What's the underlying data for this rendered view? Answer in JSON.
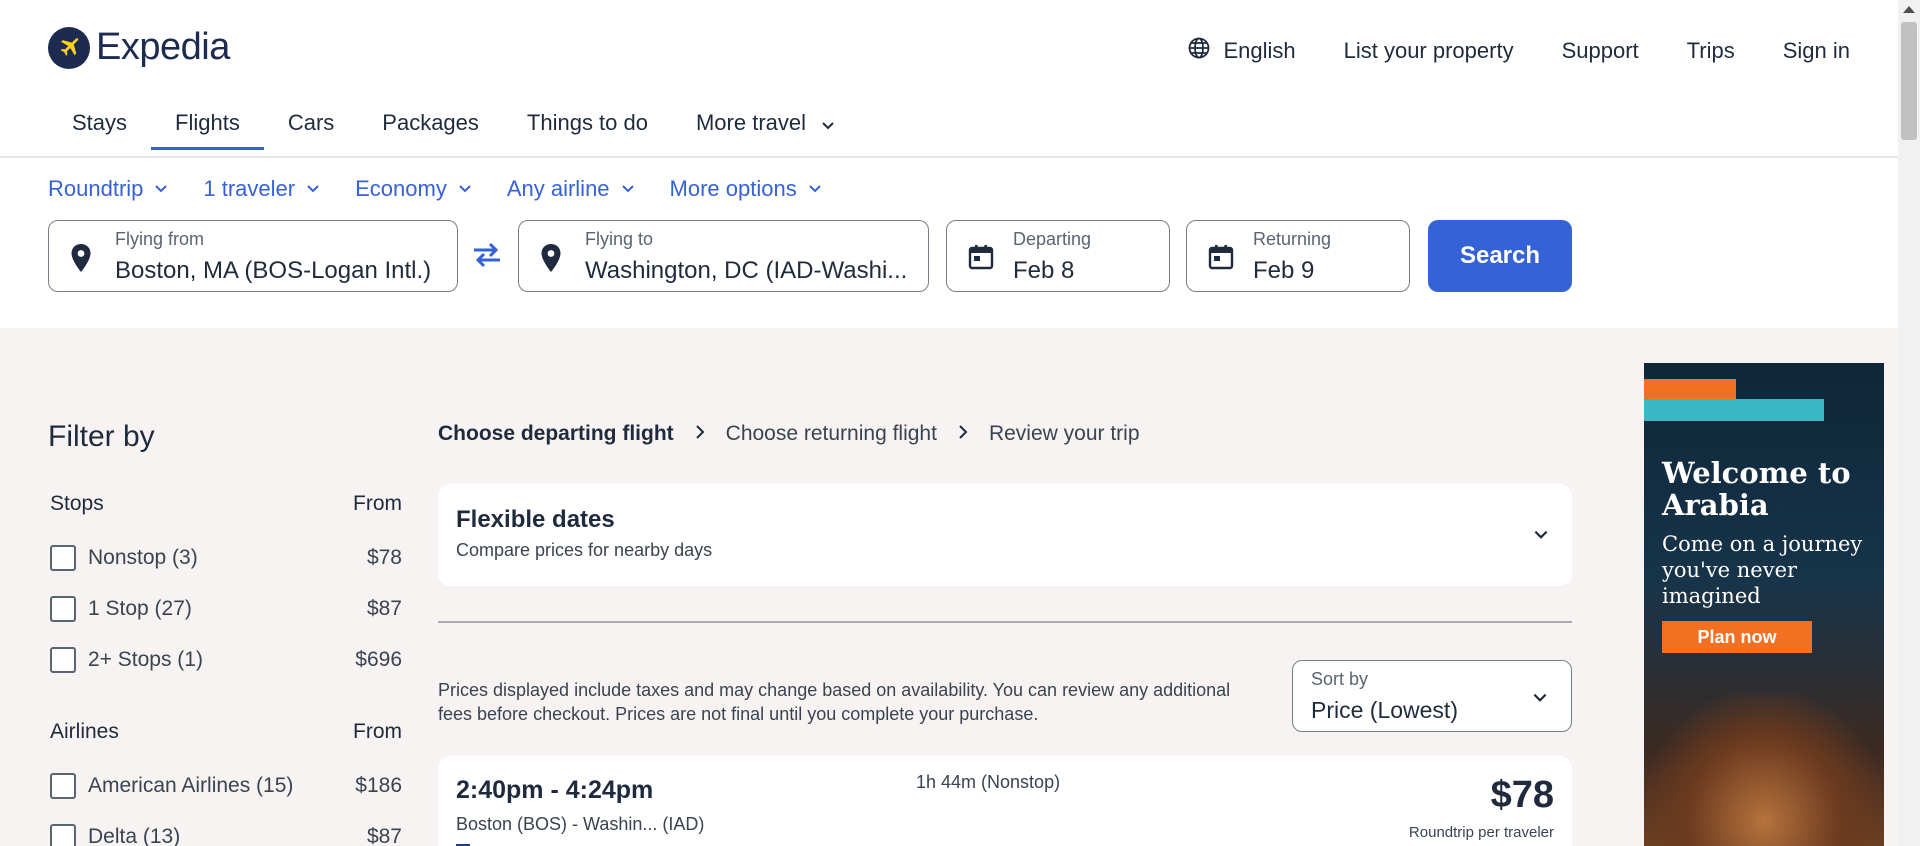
{
  "brand": {
    "name": "Expedia"
  },
  "top_nav": {
    "language": "English",
    "list_property": "List your property",
    "support": "Support",
    "trips": "Trips",
    "sign_in": "Sign in"
  },
  "tabs": [
    {
      "label": "Stays",
      "active": false
    },
    {
      "label": "Flights",
      "active": true
    },
    {
      "label": "Cars",
      "active": false
    },
    {
      "label": "Packages",
      "active": false
    },
    {
      "label": "Things to do",
      "active": false
    },
    {
      "label": "More travel",
      "active": false
    }
  ],
  "search_options": {
    "trip_type": "Roundtrip",
    "travelers": "1 traveler",
    "cabin": "Economy",
    "airline": "Any airline",
    "more": "More options"
  },
  "search_form": {
    "from": {
      "label": "Flying from",
      "value": "Boston, MA (BOS-Logan Intl.)"
    },
    "to": {
      "label": "Flying to",
      "value": "Washington, DC (IAD-Washi..."
    },
    "depart": {
      "label": "Departing",
      "value": "Feb 8"
    },
    "return": {
      "label": "Returning",
      "value": "Feb 9"
    },
    "search_button": "Search"
  },
  "filters": {
    "title": "Filter by",
    "stops": {
      "heading": "Stops",
      "from_label": "From",
      "items": [
        {
          "label": "Nonstop (3)",
          "price": "$78"
        },
        {
          "label": "1 Stop (27)",
          "price": "$87"
        },
        {
          "label": "2+ Stops (1)",
          "price": "$696"
        }
      ]
    },
    "airlines": {
      "heading": "Airlines",
      "from_label": "From",
      "items": [
        {
          "label": "American Airlines (15)",
          "price": "$186"
        },
        {
          "label": "Delta (13)",
          "price": "$87"
        }
      ]
    }
  },
  "breadcrumb": {
    "step1": "Choose departing flight",
    "step2": "Choose returning flight",
    "step3": "Review your trip"
  },
  "flexible_dates": {
    "title": "Flexible dates",
    "subtitle": "Compare prices for nearby days"
  },
  "disclaimer": "Prices displayed include taxes and may change based on availability. You can review any additional fees before checkout. Prices are not final until you complete your purchase.",
  "sort": {
    "label": "Sort by",
    "value": "Price (Lowest)"
  },
  "flights": [
    {
      "times": "2:40pm - 4:24pm",
      "route": "Boston (BOS) - Washin... (IAD)",
      "duration": "1h 44m (Nonstop)",
      "price": "$78",
      "price_note": "Roundtrip per traveler"
    }
  ],
  "ad": {
    "headline": "Welcome to Arabia",
    "body": "Come on a journey you've never imagined",
    "cta": "Plan now"
  },
  "colors": {
    "accent": "#3662d8",
    "brand_navy": "#1c2b4f",
    "page_bg": "#f6f3f2"
  }
}
